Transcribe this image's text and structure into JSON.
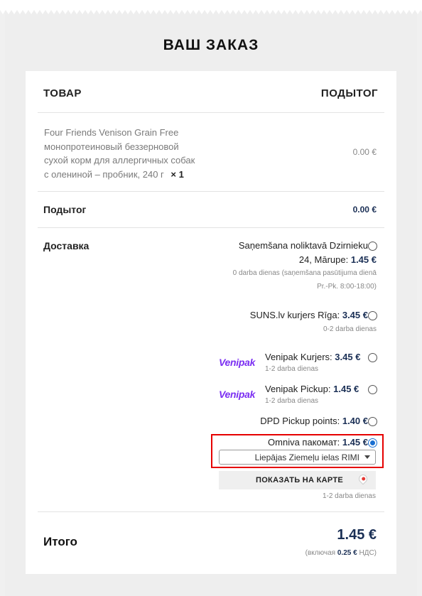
{
  "page": {
    "title": "ВАШ ЗАКАЗ"
  },
  "table": {
    "col_product": "ТОВАР",
    "col_subtotal": "ПОДЫТОГ"
  },
  "product": {
    "name_lines": [
      "Four Friends Venison Grain Free",
      "монопротеиновый беззерновой",
      "сухой корм для аллергичных собак",
      "с олениной – пробник, 240 г"
    ],
    "quantity": "× 1",
    "price": "0.00 €"
  },
  "subtotal": {
    "label": "Подытог",
    "value": "0.00 €"
  },
  "shipping": {
    "label": "Доставка",
    "options": [
      {
        "line1": "Saņemšana noliktavā Dzirnieku",
        "line2_text": "24, Mārupe:",
        "price": "1.45 €",
        "note_line1": "0 darba dienas (saņemšana pasūtijuma dienā",
        "note_line2": "Pr.-Pk. 8:00-18:00)",
        "selected": false
      },
      {
        "line1": "SUNS.lv kurjers Rīga:",
        "price": "3.45 €",
        "note_line1": "0-2 darba dienas",
        "selected": false
      },
      {
        "logo": "Venipak",
        "line1": "Venipak Kurjers:",
        "price": "3.45 €",
        "note_line1": "1-2 darba dienas",
        "selected": false
      },
      {
        "logo": "Venipak",
        "line1": "Venipak Pickup:",
        "price": "1.45 €",
        "note_line1": "1-2 darba dienas",
        "selected": false
      },
      {
        "line1": "DPD Pickup points:",
        "price": "1.40 €",
        "selected": false
      },
      {
        "line1": "Omniva пакомат:",
        "price": "1.45 €",
        "selected": true,
        "pickup_select_value": "Liepājas Ziemeļu ielas RIMI",
        "map_button": "ПОКАЗАТЬ НА КАРТЕ",
        "note_line1": "1-2 darba dienas"
      }
    ]
  },
  "total": {
    "label": "Итого",
    "value": "1.45 €",
    "vat_prefix": "(включая",
    "vat_amount": "0.25 €",
    "vat_suffix": "НДС)"
  },
  "colors": {
    "accent": "#1a2f55",
    "highlight": "#e60000",
    "radio_selected": "#1a6fd1",
    "venipak": "#7b2ff2"
  },
  "icons": {
    "map_pin": "map-pin-icon",
    "select_arrow": "chevron-down-icon"
  }
}
